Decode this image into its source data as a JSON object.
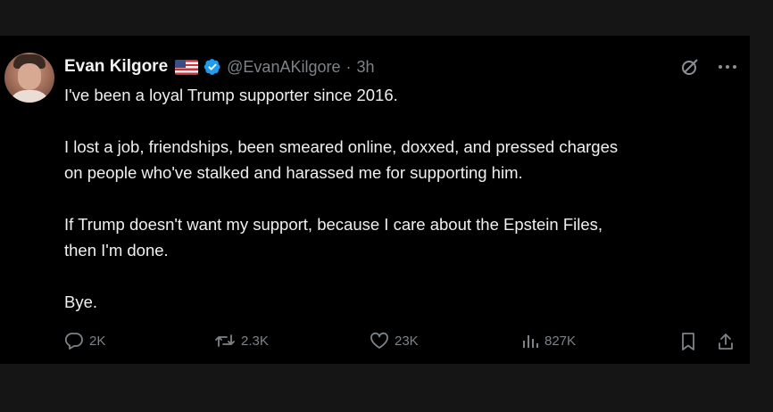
{
  "author": {
    "name": "Evan Kilgore",
    "handle": "@EvanAKilgore",
    "separator": "·",
    "time": "3h"
  },
  "icons": {
    "flag": "us-flag-icon",
    "verified": "verified-badge-icon",
    "grok": "grok-icon",
    "more": "more-icon"
  },
  "body": {
    "p1": "I've been a loyal Trump supporter since 2016.",
    "p2_line1": "I lost a job, friendships, been smeared online, doxxed, and pressed charges",
    "p2_line2": "on people who've stalked and harassed me for supporting him.",
    "p3_line1": "If Trump doesn't want my support, because I care about the Epstein Files,",
    "p3_line2": "then I'm done.",
    "p4": "Bye."
  },
  "actions": {
    "replies": "2K",
    "reposts": "2.3K",
    "likes": "23K",
    "views": "827K"
  },
  "colors": {
    "background": "#000000",
    "text": "#f0f0f0",
    "muted": "#7c8389",
    "verified": "#1d9bf0"
  }
}
